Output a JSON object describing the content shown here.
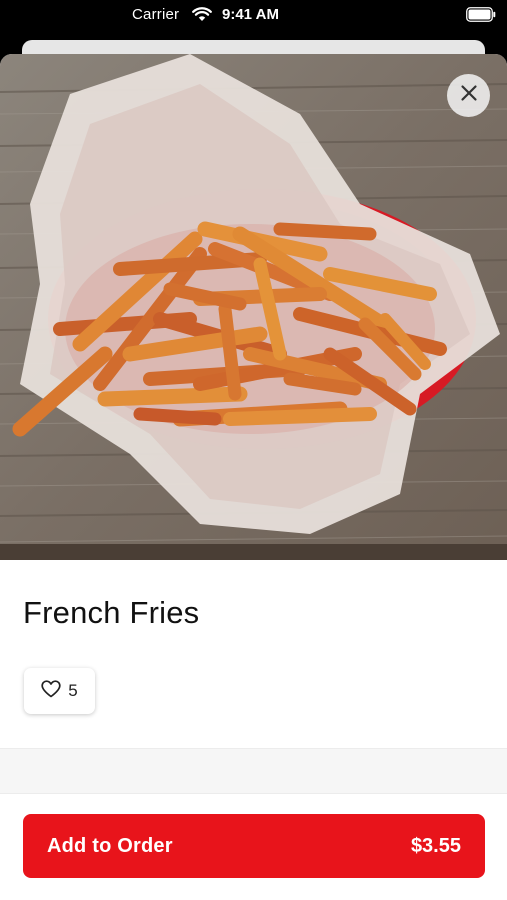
{
  "status_bar": {
    "carrier": "Carrier",
    "time": "9:41 AM"
  },
  "item": {
    "title": "French Fries",
    "likes": "5",
    "image_icon": "french-fries-photo"
  },
  "order_button": {
    "label": "Add to Order",
    "price": "$3.55"
  },
  "icons": {
    "close": "close-icon",
    "like": "heart-icon",
    "wifi": "wifi-icon",
    "battery": "battery-icon"
  },
  "colors": {
    "accent": "#e8141b",
    "basket_red": "#d71a24",
    "background": "#ffffff"
  }
}
